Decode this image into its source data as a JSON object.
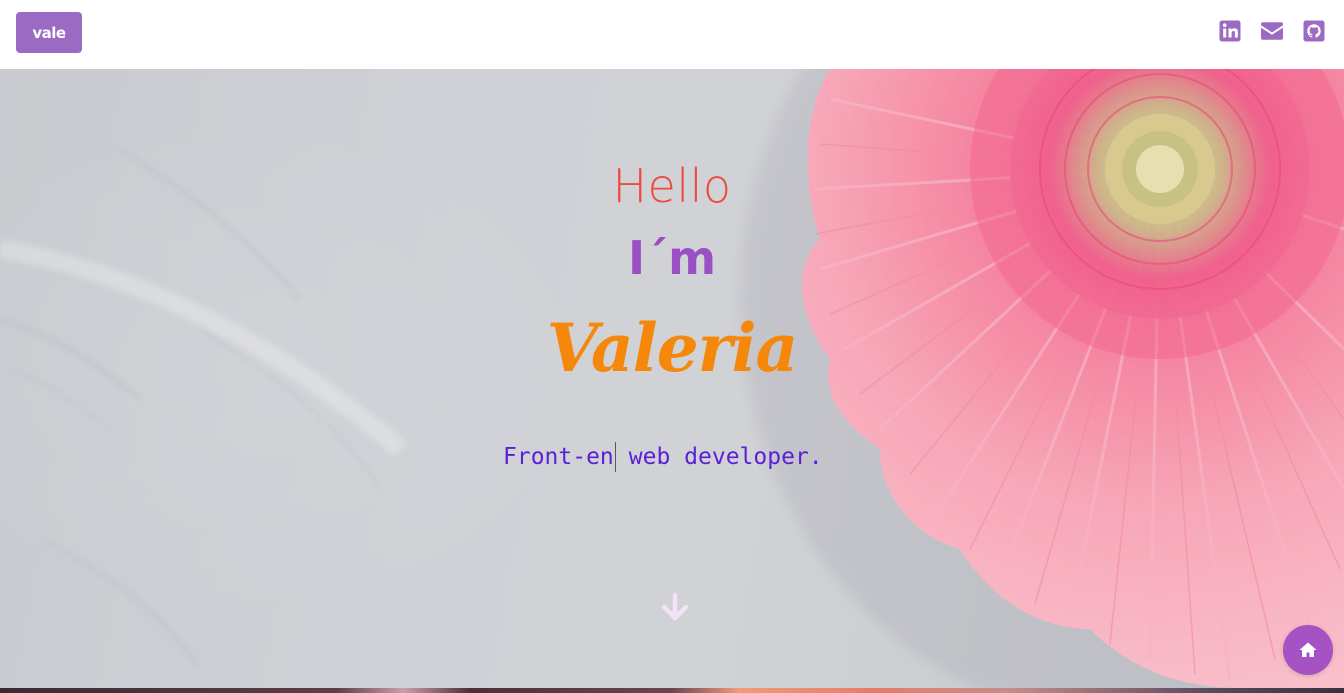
{
  "header": {
    "logo_text": "vale",
    "social_icons": [
      "linkedin-icon",
      "envelope-icon",
      "github-icon"
    ]
  },
  "hero": {
    "greeting": "Hello",
    "intro": "I´m",
    "name": "Valeria",
    "role_typed": "Front-en",
    "role_rest": "web developer."
  },
  "icons": {
    "scroll_down": "arrow-down-icon",
    "home": "home-icon"
  },
  "colors": {
    "brand_purple": "#9b6bc3",
    "greeting": "#ee4b3f",
    "intro": "#9b4fc4",
    "name": "#f5870a",
    "role": "#5a1fd6",
    "home_button": "#a652c4"
  }
}
